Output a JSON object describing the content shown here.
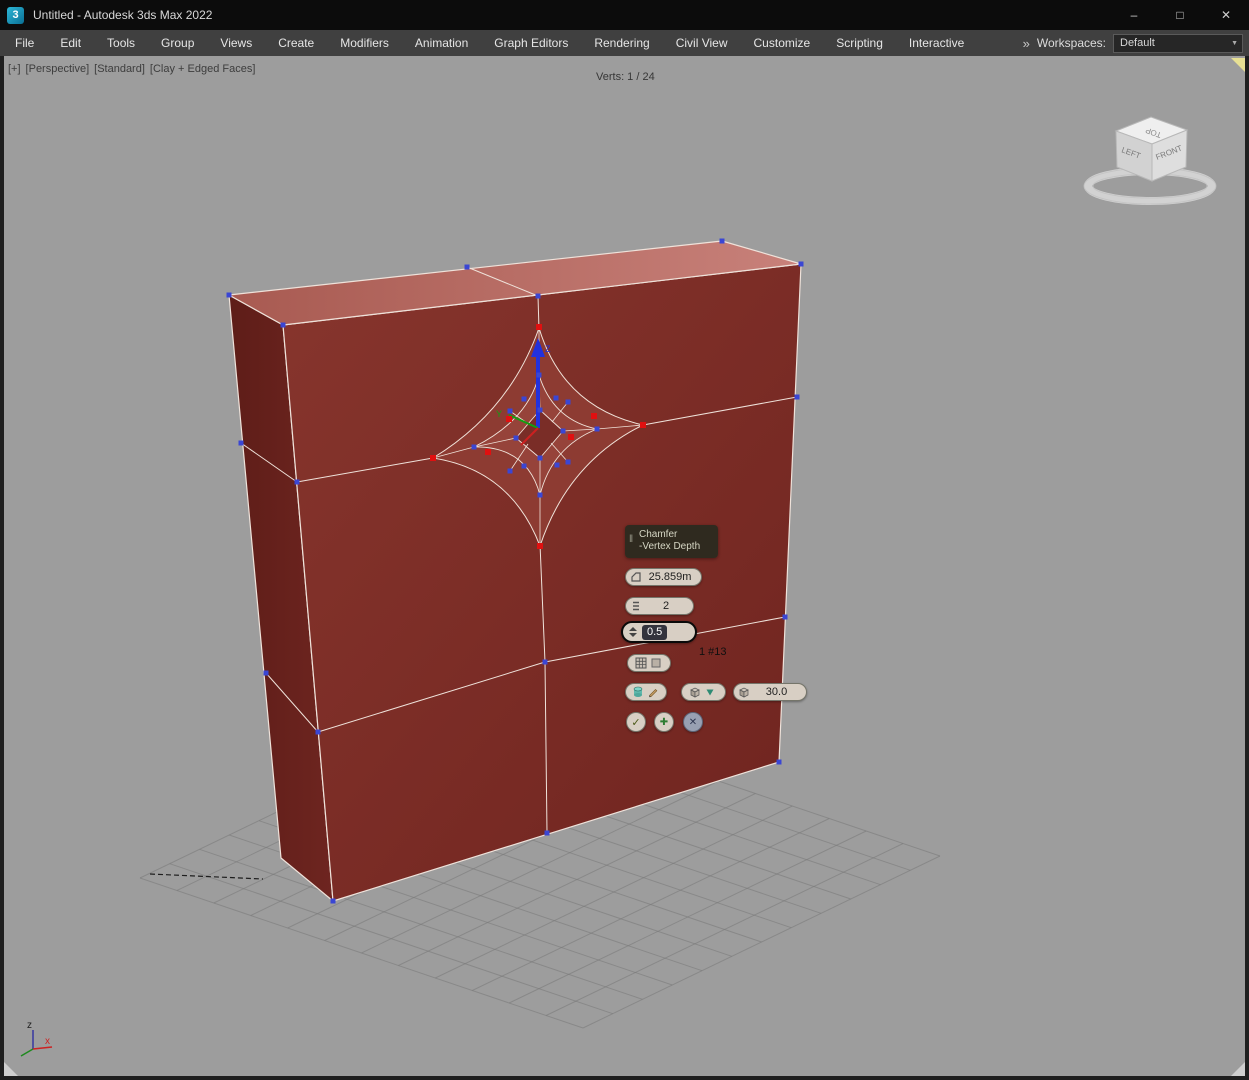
{
  "window": {
    "title": "Untitled - Autodesk 3ds Max 2022",
    "app_icon_letter": "3",
    "minimize": "–",
    "maximize": "□",
    "close": "✕"
  },
  "menu_bar": {
    "items": [
      "File",
      "Edit",
      "Tools",
      "Group",
      "Views",
      "Create",
      "Modifiers",
      "Animation",
      "Graph Editors",
      "Rendering",
      "Civil View",
      "Customize",
      "Scripting",
      "Interactive"
    ],
    "overflow_icon": "»",
    "workspaces_label": "Workspaces:",
    "workspace_value": "Default",
    "dropdown_arrow": "▼"
  },
  "viewport": {
    "label_parts": [
      "[+]",
      "[Perspective]",
      "[Standard]",
      "[Clay + Edged Faces]"
    ],
    "stats": "Verts: 1 / 24",
    "viewcube": {
      "top": "TOP",
      "left": "LEFT",
      "front": "FRONT"
    },
    "axis_tripod": {
      "x": "x",
      "z": "z"
    },
    "gizmo": {
      "y": "Y",
      "z": "Z"
    }
  },
  "caddy": {
    "grip_icon": "‖",
    "title_line1": "Chamfer",
    "title_line2": "-Vertex Depth",
    "amount_value": "25.859m",
    "segments_value": "2",
    "depth_value": "0.5",
    "count_label": "1 #13",
    "tension_value": "30.0",
    "ok_glyph": "✓",
    "apply_glyph": "✚",
    "cancel_glyph": "✕"
  },
  "colors": {
    "viewport_bg": "#9d9d9d",
    "box_front": "#7b2b25",
    "box_side": "#66211c",
    "box_top": "#bb6f65",
    "edge": "#efe2da",
    "vertex_blue": "#3a46d4",
    "vertex_selected_red": "#e01010",
    "caddy_pill": "#d8cfc4"
  }
}
